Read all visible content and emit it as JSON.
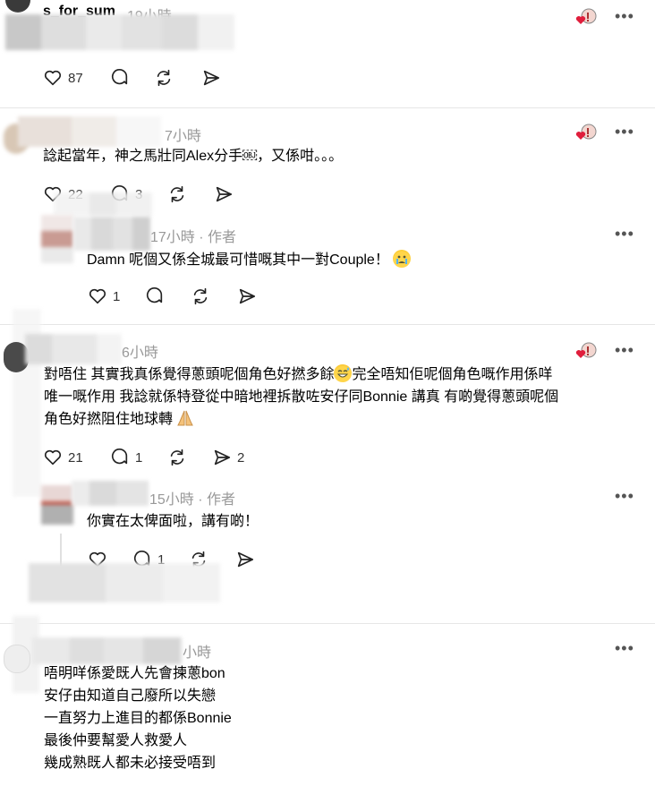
{
  "comments": [
    {
      "name": "s_for_sum",
      "time": "19小時",
      "likes": "87",
      "replies": "",
      "reposts": ""
    },
    {
      "name": "",
      "time": "7小時",
      "text": "諗起當年，神之馬壯同Alex分手￼，又係咁。。。",
      "likes": "22",
      "replies": "3",
      "reposts": ""
    },
    {
      "name": "",
      "time": "17小時 · 作者",
      "text": "Damn 呢個又係全城最可惜嘅其中一對Couple！",
      "likes": "1",
      "replies": "",
      "reposts": ""
    },
    {
      "name": "",
      "time": "6小時",
      "lines": [
        "對唔住 其實我真係覺得蔥頭呢個角色好撚多餘",
        "完全唔知佢呢個角色嘅作用係咩",
        "唯一嘅作用 我諗就係特登從中暗地裡拆散咗安仔同Bonnie 講真 有啲覺得蔥頭呢個",
        "角色好撚阻住地球轉"
      ],
      "likes": "21",
      "replies": "1",
      "reposts": "2"
    },
    {
      "name": "",
      "time": "15小時 · 作者",
      "text": "你實在太俾面啦，講有啲！",
      "likes": "",
      "replies": "1",
      "reposts": ""
    },
    {
      "name": "",
      "time": "小時",
      "lines": [
        "唔明咩係愛既人先會揀蔥bon",
        "安仔由知道自己廢所以失戀",
        "一直努力上進目的都係Bonnie",
        "最後仲要幫愛人救愛人",
        "幾成熟既人都未必接受唔到"
      ]
    }
  ],
  "more_glyph": "•••"
}
